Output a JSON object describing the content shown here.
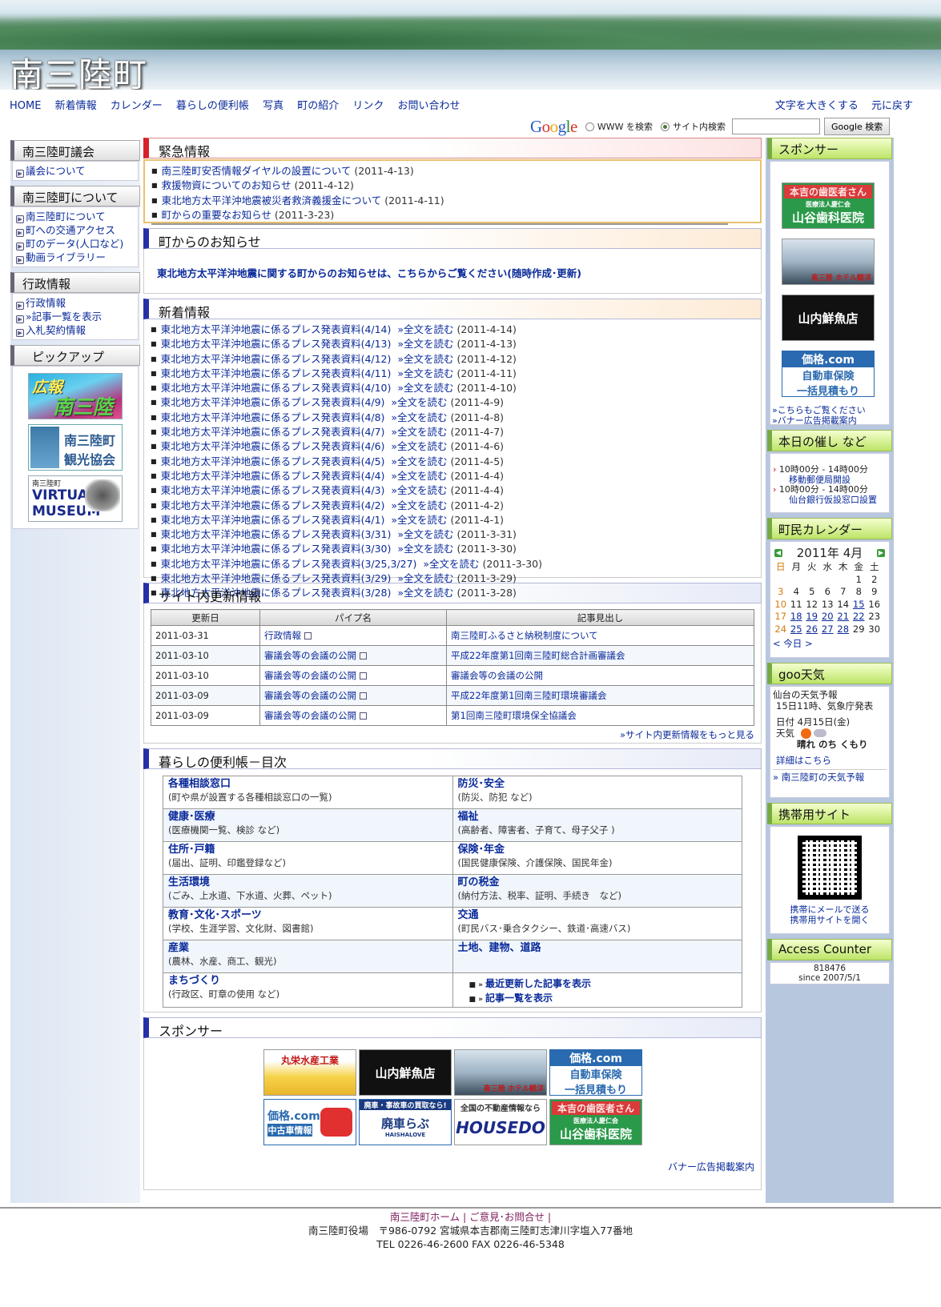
{
  "header": {
    "site_title": "南三陸町"
  },
  "topnav": [
    "HOME",
    "新着情報",
    "カレンダー",
    "暮らしの便利帳",
    "写真",
    "町の紹介",
    "リンク",
    "お問い合わせ"
  ],
  "textsize": {
    "larger": "文字を大きくする",
    "reset": "元に戻す"
  },
  "search": {
    "www_label": "WWW を検索",
    "site_label": "サイト内検索",
    "button": "Google 検索",
    "value": ""
  },
  "left": {
    "council_head": "南三陸町議会",
    "council_items": [
      "議会について"
    ],
    "town_head": "南三陸町について",
    "town_items": [
      "南三陸町について",
      "町への交通アクセス",
      "町のデータ(人口など)",
      "動画ライブラリー"
    ],
    "admin_head": "行政情報",
    "admin_items": [
      "行政情報",
      "»記事一覧を表示",
      "入札契約情報"
    ],
    "pickup_head": "ピックアップ",
    "pickup1": {
      "line1": "広報",
      "line2": "南三陸"
    },
    "pickup2": {
      "line1": "南三陸町",
      "line2": "観光協会"
    },
    "pickup3": {
      "line1": "南三陸町",
      "line2": "VIRTUAL",
      "line3": "MUSEUM"
    }
  },
  "emergency": {
    "title": "緊急情報",
    "items": [
      {
        "text": "南三陸町安否情報ダイヤルの設置について",
        "date": "(2011-4-13)"
      },
      {
        "text": "救援物資についてのお知らせ",
        "date": "(2011-4-12)"
      },
      {
        "text": "東北地方太平洋沖地震被災者救済義援金について",
        "date": "(2011-4-11)"
      },
      {
        "text": "町からの重要なお知らせ",
        "date": "(2011-3-23)"
      }
    ]
  },
  "notice": {
    "title": "町からのお知らせ",
    "text": "東北地方太平洋沖地震に関する町からのお知らせは、こちらからご覧ください(随時作成･更新)"
  },
  "news": {
    "title": "新着情報",
    "read": "»全文を読む",
    "items": [
      {
        "text": "東北地方太平洋沖地震に係るプレス発表資料(4/14)",
        "date": "(2011-4-14)"
      },
      {
        "text": "東北地方太平洋沖地震に係るプレス発表資料(4/13)",
        "date": "(2011-4-13)"
      },
      {
        "text": "東北地方太平洋沖地震に係るプレス発表資料(4/12)",
        "date": "(2011-4-12)"
      },
      {
        "text": "東北地方太平洋沖地震に係るプレス発表資料(4/11)",
        "date": "(2011-4-11)"
      },
      {
        "text": "東北地方太平洋沖地震に係るプレス発表資料(4/10)",
        "date": "(2011-4-10)"
      },
      {
        "text": "東北地方太平洋沖地震に係るプレス発表資料(4/9)",
        "date": "(2011-4-9)"
      },
      {
        "text": "東北地方太平洋沖地震に係るプレス発表資料(4/8)",
        "date": "(2011-4-8)"
      },
      {
        "text": "東北地方太平洋沖地震に係るプレス発表資料(4/7)",
        "date": "(2011-4-7)"
      },
      {
        "text": "東北地方太平洋沖地震に係るプレス発表資料(4/6)",
        "date": "(2011-4-6)"
      },
      {
        "text": "東北地方太平洋沖地震に係るプレス発表資料(4/5)",
        "date": "(2011-4-5)"
      },
      {
        "text": "東北地方太平洋沖地震に係るプレス発表資料(4/4)",
        "date": "(2011-4-4)"
      },
      {
        "text": "東北地方太平洋沖地震に係るプレス発表資料(4/3)",
        "date": "(2011-4-4)"
      },
      {
        "text": "東北地方太平洋沖地震に係るプレス発表資料(4/2)",
        "date": "(2011-4-2)"
      },
      {
        "text": "東北地方太平洋沖地震に係るプレス発表資料(4/1)",
        "date": "(2011-4-1)"
      },
      {
        "text": "東北地方太平洋沖地震に係るプレス発表資料(3/31)",
        "date": "(2011-3-31)"
      },
      {
        "text": "東北地方太平洋沖地震に係るプレス発表資料(3/30)",
        "date": "(2011-3-30)"
      },
      {
        "text": "東北地方太平洋沖地震に係るプレス発表資料(3/25,3/27)",
        "date": "(2011-3-30)"
      },
      {
        "text": "東北地方太平洋沖地震に係るプレス発表資料(3/29)",
        "date": "(2011-3-29)"
      },
      {
        "text": "東北地方太平洋沖地震に係るプレス発表資料(3/28)",
        "date": "(2011-3-28)"
      }
    ]
  },
  "updates": {
    "title": "サイト内更新情報",
    "headers": [
      "更新日",
      "パイプ名",
      "記事見出し"
    ],
    "rows": [
      [
        "2011-03-31",
        "行政情報",
        "南三陸町ふるさと納税制度について"
      ],
      [
        "2011-03-10",
        "審議会等の会議の公開",
        "平成22年度第1回南三陸町総合計画審議会"
      ],
      [
        "2011-03-10",
        "審議会等の会議の公開",
        "審議会等の会議の公開"
      ],
      [
        "2011-03-09",
        "審議会等の会議の公開",
        "平成22年度第1回南三陸町環境審議会"
      ],
      [
        "2011-03-09",
        "審議会等の会議の公開",
        "第1回南三陸町環境保全協議会"
      ]
    ],
    "more": "»サイト内更新情報をもっと見る"
  },
  "benri": {
    "title": "暮らしの便利帳－目次",
    "cells": [
      {
        "t": "各種相談窓口",
        "d": "(町や県が設置する各種相談窓口の一覧)"
      },
      {
        "t": "防災･安全",
        "d": "(防災、防犯 など)"
      },
      {
        "t": "健康･医療",
        "d": "(医療機関一覧、検診 など)"
      },
      {
        "t": "福祉",
        "d": "(高齢者、障害者、子育て、母子父子 )"
      },
      {
        "t": "住所･戸籍",
        "d": "(届出、証明、印鑑登録など)"
      },
      {
        "t": "保険･年金",
        "d": "(国民健康保険、介護保険、国民年金)"
      },
      {
        "t": "生活環境",
        "d": "(ごみ、上水道、下水道、火葬、ペット)"
      },
      {
        "t": "町の税金",
        "d": "(納付方法、税率、証明、手続き　など)"
      },
      {
        "t": "教育･文化･スポーツ",
        "d": "(学校、生涯学習、文化財、図書館)"
      },
      {
        "t": "交通",
        "d": "(町民バス･乗合タクシー、鉄道･高速バス)"
      },
      {
        "t": "産業",
        "d": "(農林、水産、商工、観光)"
      },
      {
        "t": "土地、建物、道路",
        "d": ""
      },
      {
        "t": "まちづくり",
        "d": "(行政区、町章の使用 など)"
      }
    ],
    "links": [
      "最近更新した記事を表示",
      "記事一覧を表示"
    ]
  },
  "sponsor": {
    "title": "スポンサー",
    "banners": [
      {
        "l1": "丸栄水産工業",
        "l2": ""
      },
      {
        "l1": "山内鮮魚店",
        "l2": ""
      },
      {
        "l1": "南三陸 ホテル観洋",
        "l2": ""
      },
      {
        "l1": "価格.com",
        "l2": "自動車保険",
        "l3": "一括見積もり"
      },
      {
        "l1": "価格.com",
        "l2": "中古車情報"
      },
      {
        "l1": "廃車・事故車の買取なら!",
        "l2": "廃車らぶ",
        "l3": "HAISHALOVE"
      },
      {
        "l1": "全国の不動産情報なら",
        "l2": "HOUSEDO"
      },
      {
        "l1": "本吉の歯医者さん",
        "l2": "医療法人慶仁会",
        "l3": "山谷歯科医院"
      }
    ],
    "guide": "バナー広告掲載案内"
  },
  "right": {
    "sponsor_head": "スポンサー",
    "banners": [
      {
        "l1": "本吉の歯医者さん",
        "l2": "医療法人慶仁会",
        "l3": "山谷歯科医院"
      },
      {
        "l1": "南三陸 ホテル観洋"
      },
      {
        "l1": "山内鮮魚店"
      },
      {
        "l1": "価格.com",
        "l2": "自動車保険",
        "l3": "一括見積もり"
      }
    ],
    "sponsor_more": "»こちらもご覧ください",
    "sponsor_guide": "»バナー広告掲載案内",
    "events_head": "本日の催し など",
    "events": [
      {
        "time": "10時00分 - 14時00分",
        "name": "移動郵便局開設"
      },
      {
        "time": "10時00分 - 14時00分",
        "name": "仙台銀行仮設窓口設置"
      }
    ],
    "calendar_head": "町民カレンダー",
    "cal_title": "2011年 4月",
    "cal_days": [
      "日",
      "月",
      "火",
      "水",
      "木",
      "金",
      "土"
    ],
    "cal_weeks": [
      [
        "",
        "",
        "",
        "",
        "",
        "1",
        "2"
      ],
      [
        "3",
        "4",
        "5",
        "6",
        "7",
        "8",
        "9"
      ],
      [
        "10",
        "11",
        "12",
        "13",
        "14",
        "15",
        "16"
      ],
      [
        "17",
        "18",
        "19",
        "20",
        "21",
        "22",
        "23"
      ],
      [
        "24",
        "25",
        "26",
        "27",
        "28",
        "29",
        "30"
      ]
    ],
    "cal_today": "< 今日 >",
    "weather_head": "goo天気",
    "weather_source": "仙台の天気予報",
    "weather_issued": "15日11時、気象庁発表",
    "weather_date": "日付 4月15日(金)",
    "weather_label": "天気",
    "weather_text": "晴れ のち くもり",
    "weather_more": "詳細はこちら",
    "weather_link": "» 南三陸町の天気予報",
    "mobile_head": "携帯用サイト",
    "mobile_l1": "携帯にメールで送る",
    "mobile_l2": "携帯用サイトを開く",
    "counter_head": "Access Counter",
    "counter_value": "818476",
    "counter_since": "since 2007/5/1"
  },
  "footer": {
    "links": "南三陸町ホーム | ご意見･お問合せ |",
    "address": "南三陸町役場　〒986-0792 宮城県本吉郡南三陸町志津川字塩入77番地",
    "tel": "TEL 0226-46-2600 FAX 0226-46-5348"
  }
}
